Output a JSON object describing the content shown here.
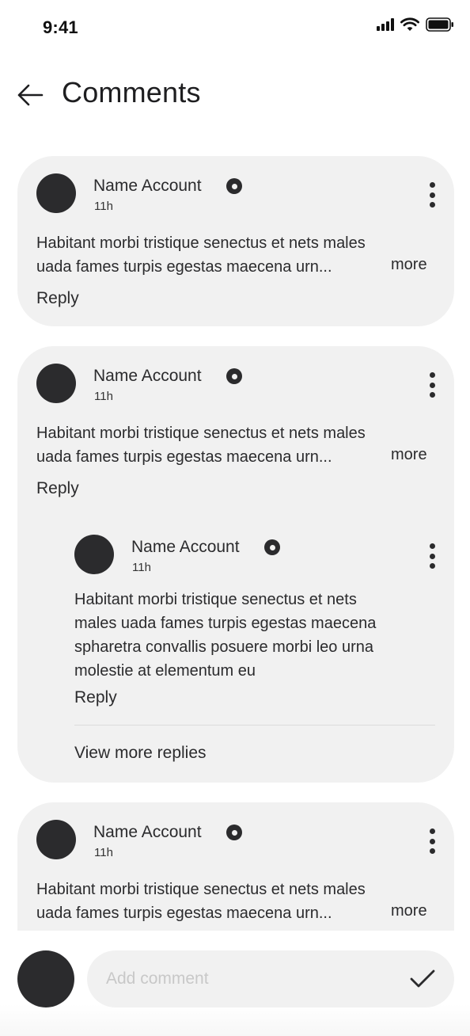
{
  "status_bar": {
    "time": "9:41"
  },
  "header": {
    "title": "Comments"
  },
  "comments": [
    {
      "author": "Name Account",
      "time": "11h",
      "text_line1": "Habitant morbi tristique senectus et nets males",
      "text_line2": "uada fames turpis egestas maecena urn...",
      "more_label": "more",
      "reply_label": "Reply"
    },
    {
      "author": "Name Account",
      "time": "11h",
      "text_line1": "Habitant morbi tristique senectus et nets males",
      "text_line2": "uada fames turpis egestas maecena urn...",
      "more_label": "more",
      "reply_label": "Reply",
      "replies": [
        {
          "author": "Name Account",
          "time": "11h",
          "text_lines": [
            "Habitant morbi tristique senectus et nets",
            "males uada fames turpis egestas maecena",
            "spharetra convallis posuere morbi leo urna",
            "molestie at elementum eu"
          ],
          "reply_label": "Reply"
        }
      ],
      "view_more_label": "View more replies"
    },
    {
      "author": "Name Account",
      "time": "11h",
      "text_line1": "Habitant morbi tristique senectus et nets males",
      "text_line2": "uada fames turpis egestas maecena urn...",
      "more_label": "more"
    }
  ],
  "composer": {
    "placeholder": "Add comment",
    "value": ""
  },
  "icons": {
    "back": "arrow-left-icon",
    "verified": "verified-badge-icon",
    "menu": "more-vertical-icon",
    "send": "checkmark-icon",
    "signal": "cellular-signal-icon",
    "wifi": "wifi-icon",
    "battery": "battery-icon"
  }
}
